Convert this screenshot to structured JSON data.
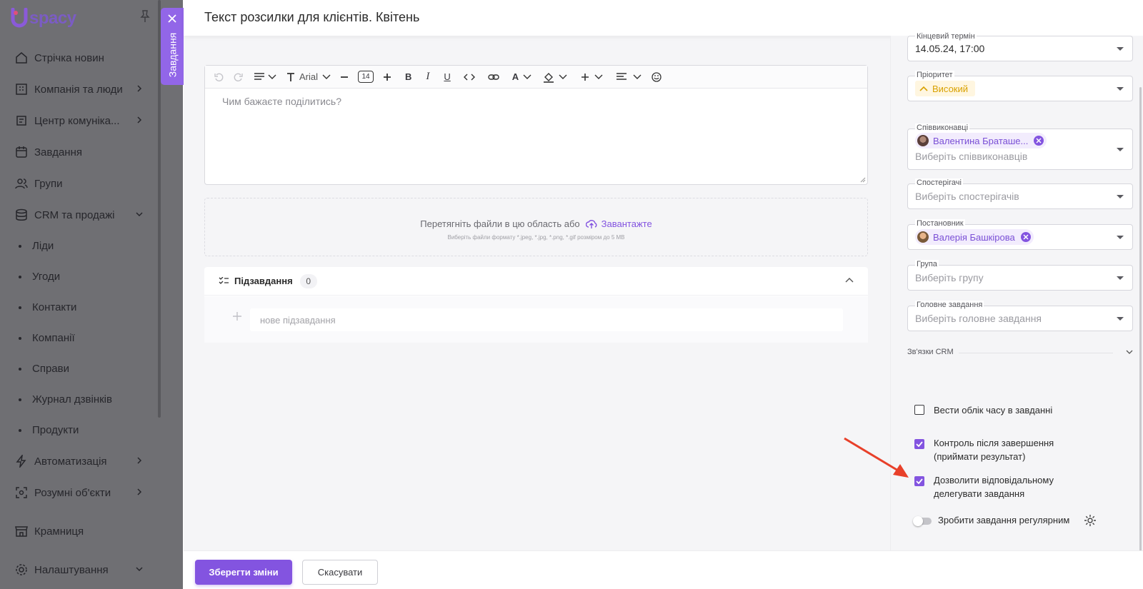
{
  "app": {
    "logo": "spacy"
  },
  "sidebar": {
    "items": [
      {
        "label": "Стрічка новин",
        "icon": "home-icon"
      },
      {
        "label": "Компанія та люди",
        "icon": "company-icon"
      },
      {
        "label": "Центр комуніка...",
        "icon": "communication-icon"
      },
      {
        "label": "Завдання",
        "icon": "calendar-icon"
      },
      {
        "label": "Групи",
        "icon": "groups-icon"
      },
      {
        "label": "CRM та продажі",
        "icon": "crm-icon"
      }
    ],
    "crm_sub": [
      "Ліди",
      "Угоди",
      "Контакти",
      "Компанії",
      "Справи",
      "Журнал дзвінків",
      "Продукти"
    ],
    "items2": [
      {
        "label": "Автоматизація",
        "icon": "automation-icon"
      },
      {
        "label": "Розумні об'єкти",
        "icon": "smart-objects-icon"
      },
      {
        "label": "Крамниця",
        "icon": "store-icon"
      },
      {
        "label": "Налаштування",
        "icon": "settings-icon"
      }
    ]
  },
  "task_tab": {
    "label": "Завдання"
  },
  "header": {
    "title": "Текст розсилки для клієнтів. Квітень"
  },
  "editor": {
    "font": "Arial",
    "font_size": "14",
    "placeholder": "Чим бажаєте поділитись?"
  },
  "dropzone": {
    "text": "Перетягніть файли в цю область або",
    "upload": "Завантажте",
    "hint": "Виберіть файли формату *.jpeg, *.jpg, *.png, *.gif розміром до 5 MB"
  },
  "subtasks": {
    "title": "Підзавдання",
    "count": "0",
    "placeholder": "нове підзавдання"
  },
  "right": {
    "deadline": {
      "label": "Кінцевий термін",
      "value": "14.05.24, 17:00"
    },
    "priority": {
      "label": "Пріоритет",
      "value": "Високий"
    },
    "coexec": {
      "label": "Співвиконавці",
      "chip": "Валентина Браташе...",
      "placeholder": "Виберіть співвиконавців"
    },
    "observers": {
      "label": "Спостерігачі",
      "placeholder": "Виберіть спостерігачів"
    },
    "creator": {
      "label": "Постановник",
      "chip": "Валерія Башкірова"
    },
    "group": {
      "label": "Група",
      "placeholder": "Виберіть групу"
    },
    "parent": {
      "label": "Головне завдання",
      "placeholder": "Виберіть головне завдання"
    },
    "crm": {
      "label": "Зв'язки CRM"
    },
    "checks": [
      {
        "label": "Вести облік часу в завданні",
        "checked": false
      },
      {
        "label": "Контроль після завершення (приймати результат)",
        "checked": true
      },
      {
        "label": "Дозволити відповідальному делегувати завдання",
        "checked": true
      }
    ],
    "recurring": {
      "label": "Зробити завдання регулярним",
      "on": false
    }
  },
  "footer": {
    "save": "Зберегти зміни",
    "cancel": "Скасувати"
  },
  "colors": {
    "accent": "#8354e0",
    "annotation": "#e8402a",
    "priority": "#d9a100"
  }
}
